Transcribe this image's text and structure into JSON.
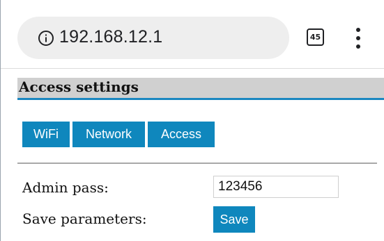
{
  "browser": {
    "url": "192.168.12.1",
    "tab_count": "45",
    "icons": {
      "site_info": "info-icon",
      "tabs": "tabs-icon",
      "menu": "more-vert-icon"
    }
  },
  "page": {
    "section_title": "Access settings",
    "tabs": [
      {
        "label": "WiFi"
      },
      {
        "label": "Network"
      },
      {
        "label": "Access"
      }
    ],
    "form": {
      "admin_pass_label": "Admin pass:",
      "admin_pass_value": "123456",
      "save_params_label": "Save parameters:",
      "save_button_label": "Save"
    },
    "colors": {
      "accent": "#0f87bd",
      "header_bg": "#d0d0d0",
      "header_underline": "#1b87c0"
    }
  }
}
